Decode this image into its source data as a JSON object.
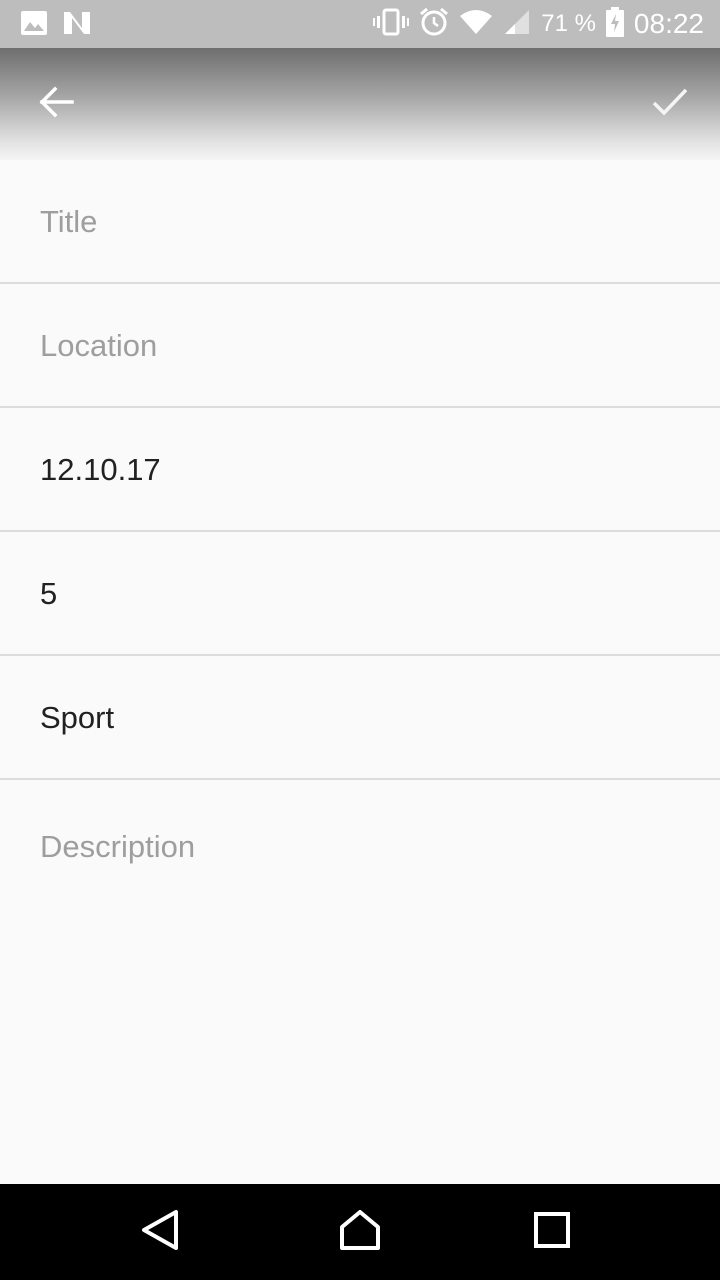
{
  "status_bar": {
    "battery_percent": "71 %",
    "time": "08:22",
    "icons": [
      "image-icon",
      "n-icon",
      "vibrate-icon",
      "alarm-icon",
      "wifi-icon",
      "signal-icon",
      "battery-charging-icon"
    ]
  },
  "toolbar": {
    "back_icon": "arrow-back-icon",
    "confirm_icon": "check-icon"
  },
  "form": {
    "title_placeholder": "Title",
    "location_placeholder": "Location",
    "date_value": "12.10.17",
    "number_value": "5",
    "category_value": "Sport",
    "description_placeholder": "Description"
  },
  "nav_bar": {
    "icons": [
      "back-triangle-icon",
      "home-icon",
      "recents-icon"
    ]
  },
  "colors": {
    "background": "#fafafa",
    "status_bar": "#bdbdbd",
    "divider": "#dcdcdc",
    "placeholder": "#9e9e9e",
    "text": "#212121",
    "nav_bar": "#000000"
  }
}
